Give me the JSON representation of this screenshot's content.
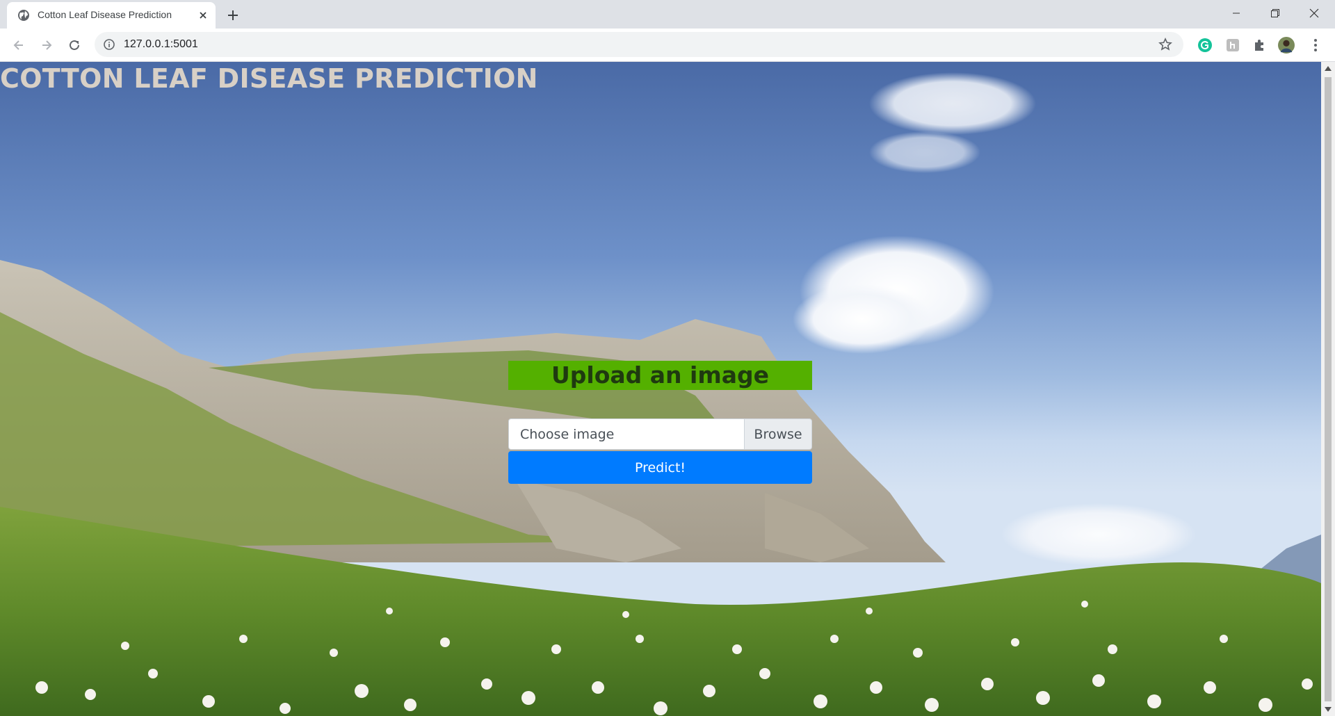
{
  "browser": {
    "tab_title": "Cotton Leaf Disease Prediction",
    "url": "127.0.0.1:5001"
  },
  "page": {
    "title": "COTTON LEAF DISEASE PREDICTION",
    "upload_heading": "Upload an image",
    "file_input_placeholder": "Choose image",
    "browse_label": "Browse",
    "predict_label": "Predict!"
  },
  "colors": {
    "heading_bg": "#54b000",
    "predict_bg": "#007bff"
  }
}
